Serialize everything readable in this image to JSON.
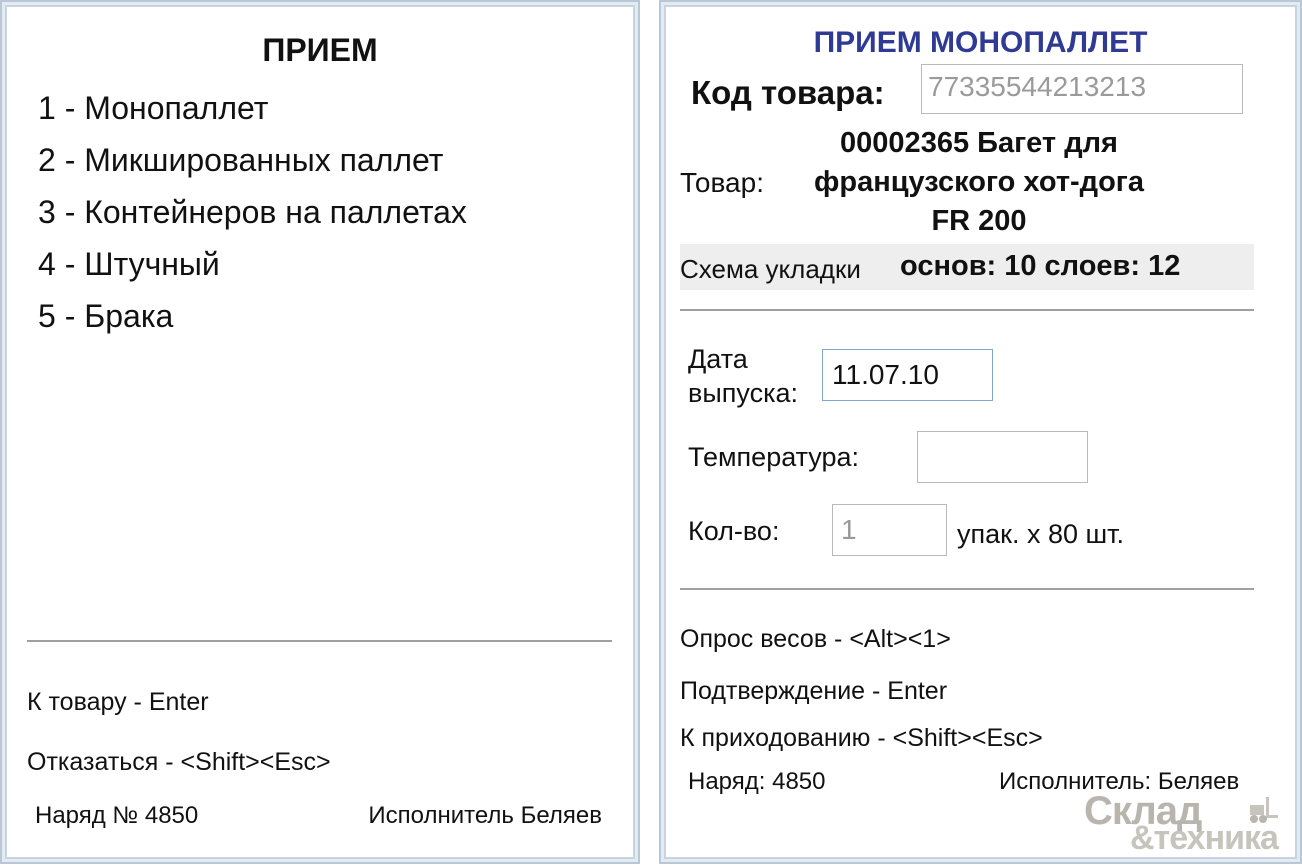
{
  "left_screen": {
    "title": "ПРИЕМ",
    "menu_items": [
      {
        "label": "1 - Монопаллет"
      },
      {
        "label": "2 - Микшированных паллет"
      },
      {
        "label": "3 - Контейнеров на паллетах"
      },
      {
        "label": "4 - Штучный"
      },
      {
        "label": "5 - Брака"
      }
    ],
    "hints": {
      "to_goods": "К товару - Enter",
      "cancel": "Отказаться - <Shift><Esc>"
    },
    "footer": {
      "order": "Наряд № 4850",
      "executor": "Исполнитель Беляев"
    }
  },
  "right_screen": {
    "title": "ПРИЕМ МОНОПАЛЛЕТ",
    "product_code": {
      "label": "Код товара:",
      "value": "77335544213213"
    },
    "goods": {
      "label": "Товар:",
      "name_lines": [
        "00002365 Багет для",
        "французского хот-дога",
        "FR 200"
      ]
    },
    "scheme": {
      "label": "Схема укладки",
      "value": "основ: 10 слоев: 12"
    },
    "release_date": {
      "label_lines": [
        "Дата",
        "выпуска:"
      ],
      "value": "11.07.10"
    },
    "temperature": {
      "label": "Температура:",
      "value": ""
    },
    "quantity": {
      "label": "Кол-во:",
      "value": "1",
      "unit": "упак. х 80 шт."
    },
    "hints": {
      "weigh": "Опрос весов - <Alt><1>",
      "confirm": "Подтверждение - Enter",
      "to_receipt": "К приходованию - <Shift><Esc>"
    },
    "footer": {
      "order": "Наряд: 4850",
      "executor": "Исполнитель: Беляев"
    }
  },
  "watermark": {
    "line1": "Склад",
    "line2": "&техника"
  }
}
